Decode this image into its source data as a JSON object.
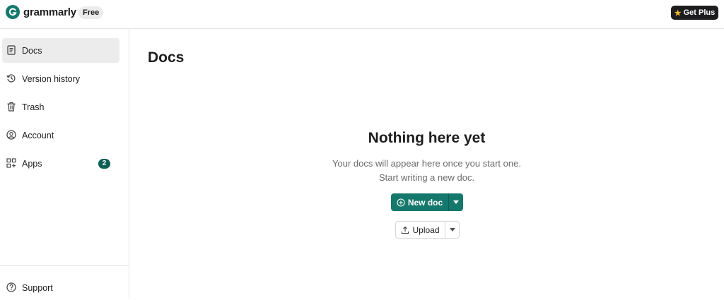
{
  "header": {
    "brand_name": "grammarly",
    "plan_badge": "Free",
    "get_plus_label": "Get Plus",
    "logo_icon": "grammarly-logo-icon",
    "star_icon": "star-icon"
  },
  "sidebar": {
    "items": [
      {
        "label": "Docs",
        "icon": "document-icon",
        "active": true
      },
      {
        "label": "Version history",
        "icon": "history-icon"
      },
      {
        "label": "Trash",
        "icon": "trash-icon"
      },
      {
        "label": "Account",
        "icon": "account-icon"
      },
      {
        "label": "Apps",
        "icon": "apps-icon",
        "count": "2"
      }
    ],
    "support": {
      "label": "Support",
      "icon": "help-icon"
    }
  },
  "main": {
    "title": "Docs",
    "empty_state": {
      "title": "Nothing here yet",
      "line1": "Your docs will appear here once you start one.",
      "line2": "Start writing a new doc."
    },
    "new_doc_label": "New doc",
    "upload_label": "Upload"
  },
  "colors": {
    "accent": "#15786c",
    "badge_bg": "#0e5f55",
    "active_bg": "#ececec",
    "get_plus_bg": "#1d1d1f",
    "star": "#f5b731"
  }
}
